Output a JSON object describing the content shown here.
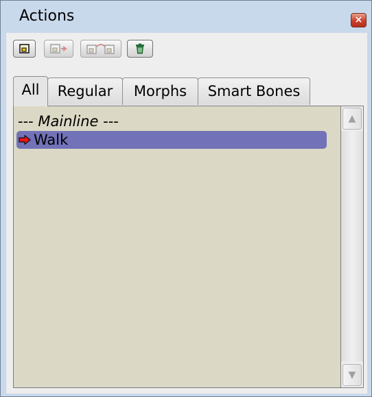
{
  "window": {
    "title": "Actions",
    "close_glyph": "×"
  },
  "toolbar": {
    "buttons": [
      {
        "icon": "new-action-icon",
        "enabled": true
      },
      {
        "icon": "copy-action-icon",
        "enabled": false
      },
      {
        "icon": "duplicate-action-icon",
        "enabled": false
      },
      {
        "icon": "trash-icon",
        "enabled": true
      }
    ]
  },
  "tabs": [
    {
      "label": "All",
      "active": true
    },
    {
      "label": "Regular",
      "active": false
    },
    {
      "label": "Morphs",
      "active": false
    },
    {
      "label": "Smart Bones",
      "active": false
    }
  ],
  "list": {
    "mainline_prefix": "--- ",
    "mainline_label": "Mainline",
    "mainline_suffix": " ---",
    "items": [
      {
        "label": "Walk",
        "selected": true,
        "icon": "red-arrow-icon"
      }
    ]
  },
  "scrollbar": {
    "up_glyph": "▲",
    "down_glyph": "▼"
  },
  "colors": {
    "list_background": "#dbd8c5",
    "selection": "#7272b8",
    "window_frame": "#c9d9ec",
    "close_button": "#c9402a",
    "arrow": "#e8141a"
  }
}
